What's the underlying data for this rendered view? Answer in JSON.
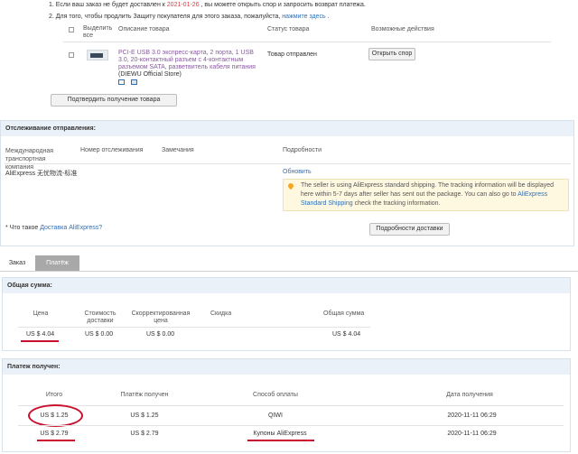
{
  "top_notice": {
    "line1_prefix": "1. Если ваш заказ не будет доставлен к",
    "line1_date": "2021-01-26",
    "line1_suffix": ", вы можете открыть спор и запросить возврат платежа.",
    "line2_text": "2. Для того, чтобы продлить Защиту покупателя для этого заказа, пожалуйста,",
    "line2_link": "нажмите здесь"
  },
  "items_table": {
    "headers": {
      "select_all": "Выделить все",
      "description": "Описание товара",
      "status": "Статус товара",
      "actions": "Возможные действия"
    },
    "row": {
      "product_title": "PCI-E USB 3.0 экспресс-карта, 2 порта, 1 USB 3.0, 20-контактный разъем с 4-контактным разъемом SATA, разветвитель кабеля питания",
      "store": "(DIEWU Official Store)",
      "status": "Товар отправлен",
      "open_dispute": "Открыть спор"
    },
    "confirm_button": "Подтвердить получение товара"
  },
  "tracking": {
    "title": "Отслеживание отправления:",
    "headers": {
      "carrier": "Международная транспортная компания",
      "tracking_number": "Номер отслеживания",
      "remarks": "Замечания",
      "details": "Подробности"
    },
    "carrier_value": "AliExpress 无忧物流-标准",
    "refresh": "Обновить",
    "info_text_1": "The seller is using AliExpress standard shipping. The tracking information will be displayed here within 5-7 days after seller has sent out the package. You can also go to",
    "info_link": "AliExpress Standard Shipping",
    "info_text_2": "check the tracking information.",
    "what_is_prefix": "* Что такое",
    "what_is_link": "Доставка AliExpress?",
    "delivery_details_button": "Подробности доставки"
  },
  "tabs": [
    {
      "label": "Заказ",
      "active": false
    },
    {
      "label": "Платёж",
      "active": true
    }
  ],
  "total": {
    "title": "Общая сумма:",
    "headers": {
      "price": "Цена",
      "shipping": "Стоимость доставки",
      "adjusted": "Скорректированная цена",
      "discount": "Скидка",
      "total": "Общая сумма"
    },
    "values": {
      "price": "US $ 4.04",
      "shipping": "US $ 0.00",
      "adjusted": "US $ 0.00",
      "total": "US $ 4.04"
    }
  },
  "payments": {
    "title": "Платеж получен:",
    "headers": {
      "total": "Итого",
      "received": "Платёж получен",
      "method": "Способ оплаты",
      "date": "Дата получения"
    },
    "rows": [
      {
        "total": "US $ 1.25",
        "received": "US $ 1.25",
        "method": "QIWI",
        "date": "2020-11-11 06:29"
      },
      {
        "total": "US $ 2.79",
        "received": "US $ 2.79",
        "method": "Купоны AliExpress",
        "date": "2020-11-11 06:29"
      }
    ]
  },
  "colors": {
    "annotation": "#c8102e",
    "link": "#2f6fb5",
    "header_bg": "#eaf1f8",
    "info_bg": "#fff8e1"
  }
}
